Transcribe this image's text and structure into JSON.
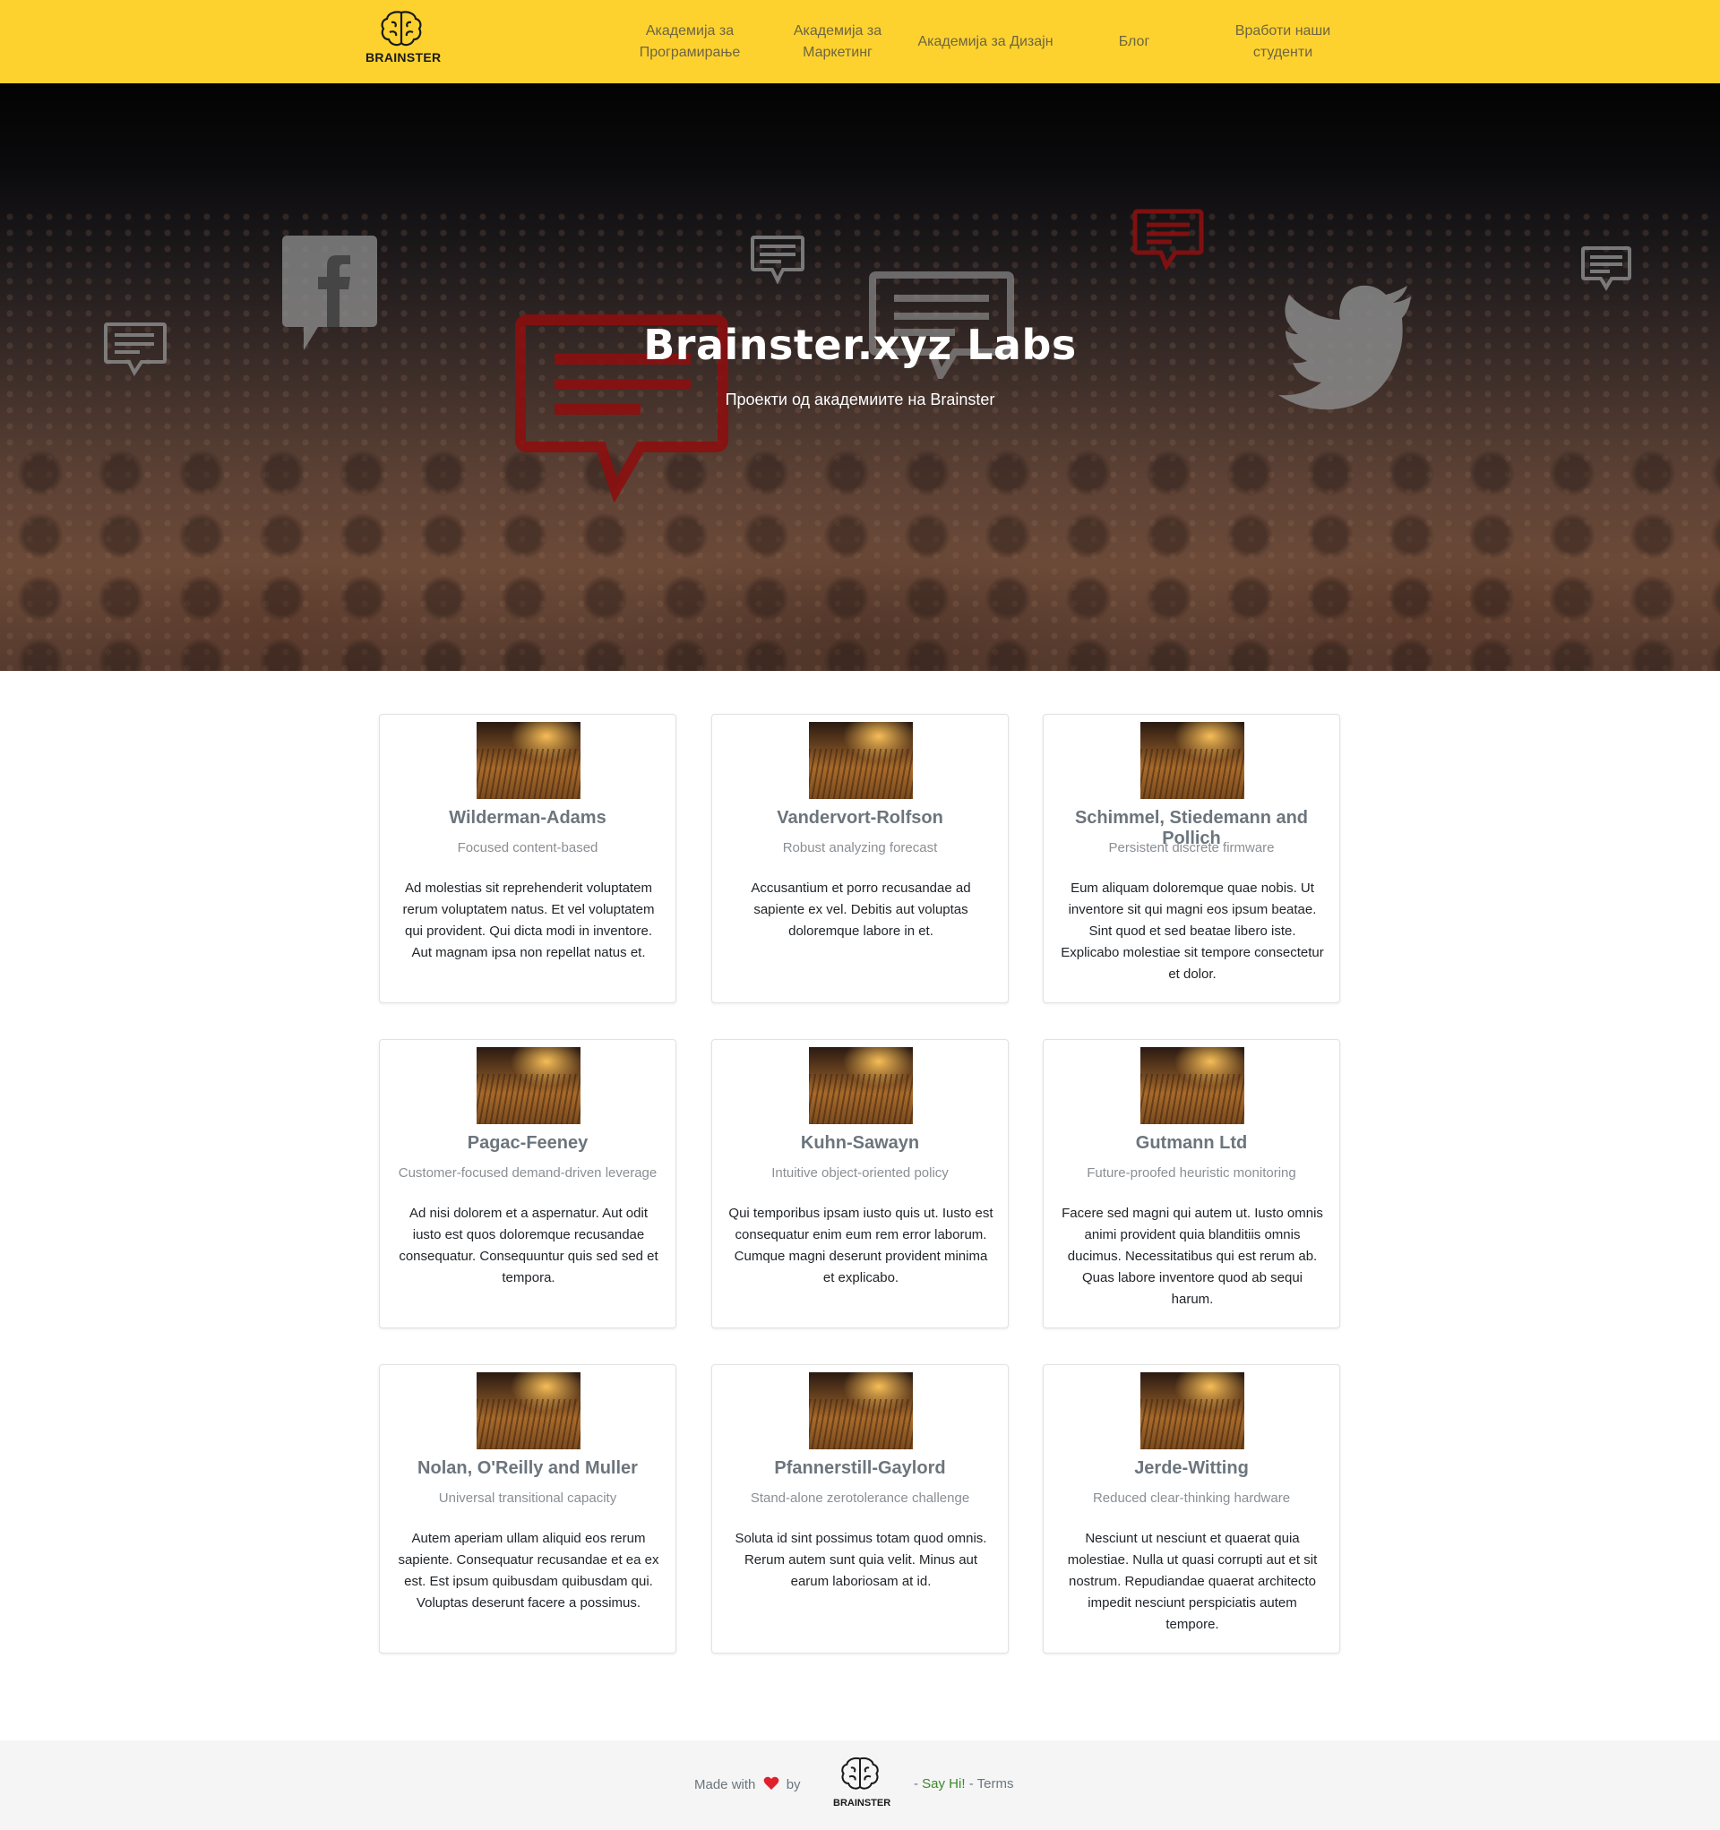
{
  "header": {
    "logo_text": "BRAINSTER",
    "nav": [
      {
        "label": "Академија за Програмирање"
      },
      {
        "label": "Академија за Маркетинг"
      },
      {
        "label": "Академија за Дизајн"
      },
      {
        "label": "Блог"
      },
      {
        "label": "Вработи наши студенти"
      }
    ],
    "brand_color": "#fdd22f"
  },
  "hero": {
    "title": "Brainster.xyz Labs",
    "subtitle": "Проекти од академиите на Brainster"
  },
  "cards": [
    {
      "title": "Wilderman-Adams",
      "subtitle": "Focused content-based",
      "text": "Ad molestias sit reprehenderit voluptatem rerum voluptatem natus. Et vel voluptatem qui provident. Qui dicta modi in inventore. Aut magnam ipsa non repellat natus et."
    },
    {
      "title": "Vandervort-Rolfson",
      "subtitle": "Robust analyzing forecast",
      "text": "Accusantium et porro recusandae ad sapiente ex vel. Debitis aut voluptas doloremque labore in et."
    },
    {
      "title": "Schimmel, Stiedemann and Pollich",
      "subtitle": "Persistent discrete firmware",
      "text": "Eum aliquam doloremque quae nobis. Ut inventore sit qui magni eos ipsum beatae. Sint quod et sed beatae libero iste. Explicabo molestiae sit tempore consectetur et dolor."
    },
    {
      "title": "Pagac-Feeney",
      "subtitle": "Customer-focused demand-driven leverage",
      "text": "Ad nisi dolorem et a aspernatur. Aut odit iusto est quos doloremque recusandae consequatur. Consequuntur quis sed sed et tempora."
    },
    {
      "title": "Kuhn-Sawayn",
      "subtitle": "Intuitive object-oriented policy",
      "text": "Qui temporibus ipsam iusto quis ut. Iusto est consequatur enim eum rem error laborum. Cumque magni deserunt provident minima et explicabo."
    },
    {
      "title": "Gutmann Ltd",
      "subtitle": "Future-proofed heuristic monitoring",
      "text": "Facere sed magni qui autem ut. Iusto omnis animi provident quia blanditiis omnis ducimus. Necessitatibus qui est rerum ab. Quas labore inventore quod ab sequi harum."
    },
    {
      "title": "Nolan, O'Reilly and Muller",
      "subtitle": "Universal transitional capacity",
      "text": "Autem aperiam ullam aliquid eos rerum sapiente. Consequatur recusandae et ea ex est. Est ipsum quibusdam quibusdam qui. Voluptas deserunt facere a possimus."
    },
    {
      "title": "Pfannerstill-Gaylord",
      "subtitle": "Stand-alone zerotolerance challenge",
      "text": "Soluta id sint possimus totam quod omnis. Rerum autem sunt quia velit. Minus aut earum laboriosam at id."
    },
    {
      "title": "Jerde-Witting",
      "subtitle": "Reduced clear-thinking hardware",
      "text": "Nesciunt ut nesciunt et quaerat quia molestiae. Nulla ut quasi corrupti aut et sit nostrum. Repudiandae quaerat architecto impedit nesciunt perspiciatis autem tempore."
    }
  ],
  "footer": {
    "made_with": "Made with",
    "by": "by",
    "logo_text": "BRAINSTER",
    "separator": "-",
    "say_hi": "Say Hi!",
    "terms": "Terms",
    "heart_color": "#e0202a"
  }
}
